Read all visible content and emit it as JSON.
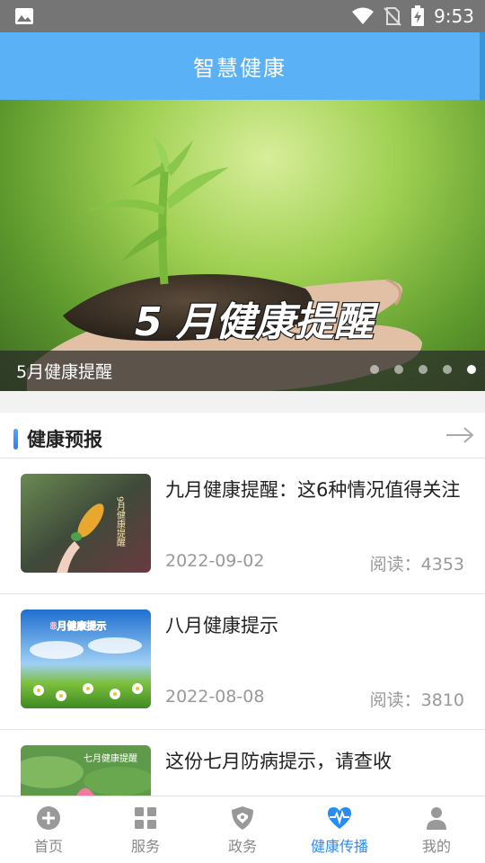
{
  "status_bar": {
    "time": "9:53",
    "icons": [
      "gallery-icon",
      "wifi-icon",
      "no-sim-icon",
      "battery-charging-icon"
    ]
  },
  "header": {
    "title": "智慧健康"
  },
  "banner": {
    "caption": "5月健康提醒",
    "overlay_text": "5 月健康提醒",
    "slide_count": 5,
    "active_slide": 5
  },
  "section": {
    "title": "健康预报",
    "more_icon": "arrow-right-icon"
  },
  "news": [
    {
      "title": "九月健康提醒：这6种情况值得关注",
      "date": "2022-09-02",
      "reads": "阅读：4353",
      "thumb_text": "9月健康提醒"
    },
    {
      "title": "八月健康提示",
      "date": "2022-08-08",
      "reads": "阅读：3810",
      "thumb_text": "8月健康提示"
    },
    {
      "title": "这份七月防病提示，请查收",
      "date": "",
      "reads": "",
      "thumb_text": "七月健康提醒"
    }
  ],
  "bottom_nav": [
    {
      "label": "首页",
      "icon": "home-plus-icon"
    },
    {
      "label": "服务",
      "icon": "grid-icon"
    },
    {
      "label": "政务",
      "icon": "shield-icon"
    },
    {
      "label": "健康传播",
      "icon": "heart-pulse-icon",
      "active": true
    },
    {
      "label": "我的",
      "icon": "person-icon"
    }
  ],
  "colors": {
    "header": "#5ab1f5",
    "accent": "#2a8cf2",
    "status_bar": "#757575"
  }
}
